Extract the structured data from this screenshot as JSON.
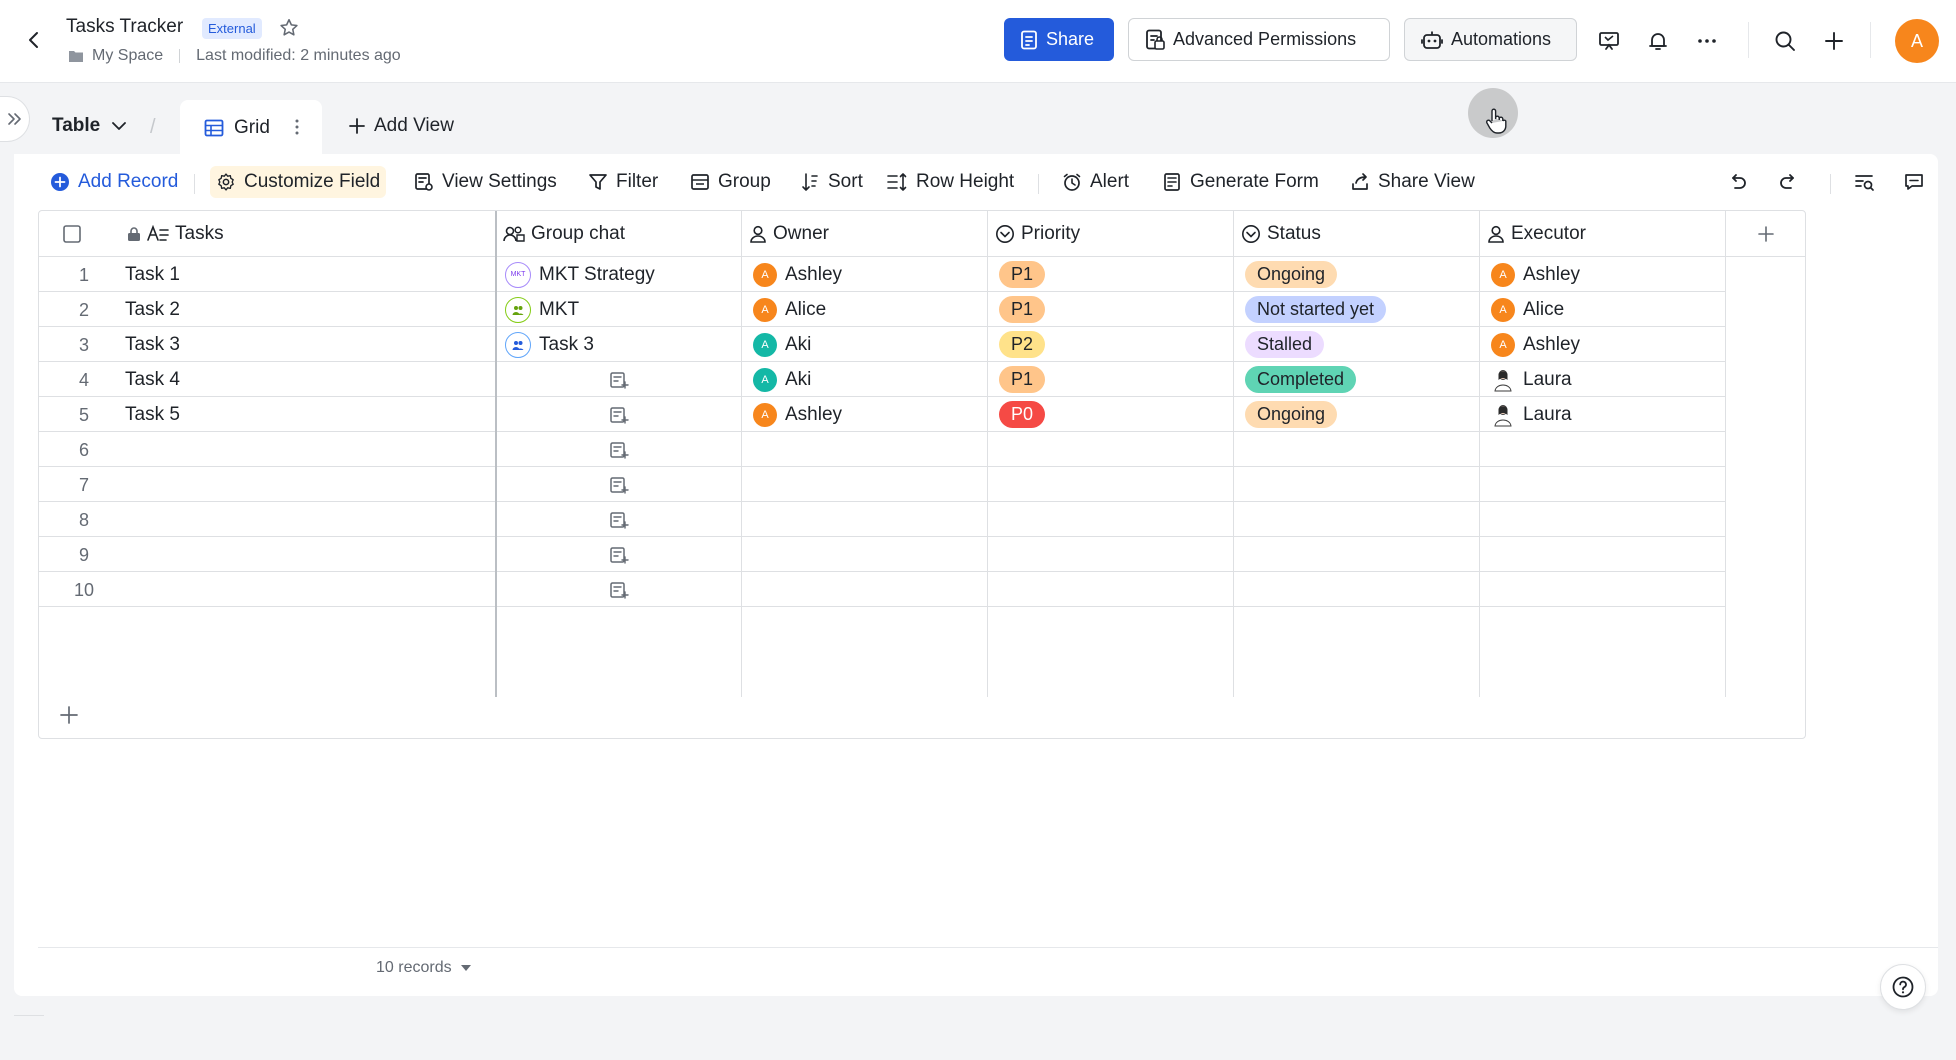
{
  "header": {
    "title": "Tasks Tracker",
    "badge": "External",
    "location": "My Space",
    "modified": "Last modified: 2 minutes ago",
    "share_label": "Share",
    "permissions_label": "Advanced Permissions",
    "automations_label": "Automations",
    "avatar_initial": "A"
  },
  "views": {
    "table_label": "Table",
    "grid_label": "Grid",
    "add_view_label": "Add View"
  },
  "toolbar": {
    "add_record": "Add Record",
    "customize_field": "Customize Field",
    "view_settings": "View Settings",
    "filter": "Filter",
    "group": "Group",
    "sort": "Sort",
    "row_height": "Row Height",
    "alert": "Alert",
    "generate_form": "Generate Form",
    "share_view": "Share View"
  },
  "columns": {
    "tasks": "Tasks",
    "group_chat": "Group chat",
    "owner": "Owner",
    "priority": "Priority",
    "status": "Status",
    "executor": "Executor"
  },
  "rows": [
    {
      "num": "1",
      "task": "Task 1",
      "chat": "MKT Strategy",
      "chat_icon": "MKT",
      "owner": "Ashley",
      "owner_initial": "A",
      "priority": "P1",
      "status": "Ongoing",
      "executor": "Ashley",
      "executor_initial": "A"
    },
    {
      "num": "2",
      "task": "Task 2",
      "chat": "MKT",
      "owner": "Alice",
      "owner_initial": "A",
      "priority": "P1",
      "status": "Not started yet",
      "executor": "Alice",
      "executor_initial": "A"
    },
    {
      "num": "3",
      "task": "Task 3",
      "chat": "Task 3",
      "owner": "Aki",
      "owner_initial": "A",
      "priority": "P2",
      "status": "Stalled",
      "executor": "Ashley",
      "executor_initial": "A"
    },
    {
      "num": "4",
      "task": "Task 4",
      "chat": "",
      "owner": "Aki",
      "owner_initial": "A",
      "priority": "P1",
      "status": "Completed",
      "executor": "Laura"
    },
    {
      "num": "5",
      "task": "Task 5",
      "chat": "",
      "owner": "Ashley",
      "owner_initial": "A",
      "priority": "P0",
      "status": "Ongoing",
      "executor": "Laura"
    },
    {
      "num": "6"
    },
    {
      "num": "7"
    },
    {
      "num": "8"
    },
    {
      "num": "9"
    },
    {
      "num": "10"
    }
  ],
  "footer": {
    "records": "10 records"
  },
  "colors": {
    "primary": "#245bdb",
    "avatar_orange": "#f7861c",
    "avatar_teal": "#14b8a6",
    "p1": "#ffc58a",
    "p2": "#ffe28a",
    "p0": "#f54a45",
    "ongoing": "#fedbb1",
    "not_started": "#c3d1ff",
    "stalled": "#ecdcff",
    "completed": "#5fd4b4"
  }
}
